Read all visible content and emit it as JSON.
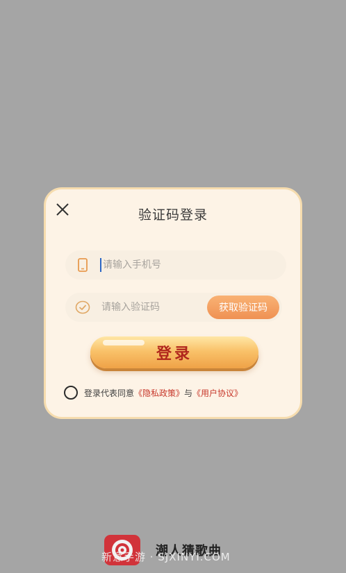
{
  "dialog": {
    "title": "验证码登录",
    "phone": {
      "placeholder": "请输入手机号"
    },
    "code": {
      "placeholder": "请输入验证码",
      "get_code_label": "获取验证码"
    },
    "login_label": "登录",
    "agreement": {
      "prefix": "登录代表同意",
      "privacy_link": "《隐私政策》",
      "and": "与",
      "user_link": "《用户协议》"
    }
  },
  "footer": {
    "app_name": "潮人猜歌曲",
    "watermark": "新意手游 · SJXINYI.COM"
  },
  "colors": {
    "background": "#a5a5a5",
    "dialog_bg": "#fdf3e6",
    "accent_orange": "#ef9153",
    "login_text": "#b0261c",
    "link_red": "#c7372a"
  }
}
